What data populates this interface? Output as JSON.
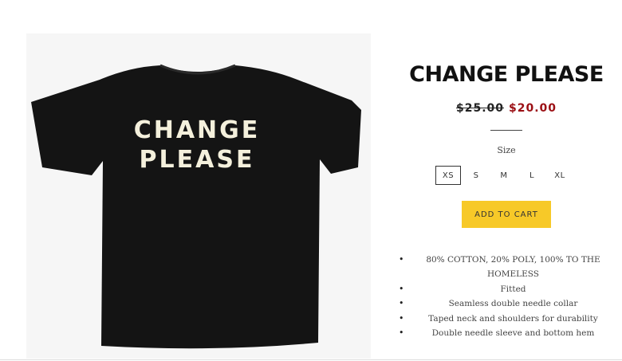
{
  "product": {
    "title": "CHANGE PLEASE",
    "price_original": "$25.00",
    "price_sale": "$20.00",
    "shirt_print_line1": "CHANGE",
    "shirt_print_line2": "PLEASE"
  },
  "size_selector": {
    "label": "Size",
    "options": [
      "XS",
      "S",
      "M",
      "L",
      "XL"
    ],
    "selected": "XS"
  },
  "add_to_cart_label": "ADD TO CART",
  "features": [
    "80% COTTON, 20% POLY, 100% TO THE HOMELESS",
    "Fitted",
    "Seamless double needle collar",
    "Taped neck and shoulders for durability",
    "Double needle sleeve and bottom hem"
  ],
  "colors": {
    "sale_price": "#9b0f14",
    "button": "#f7c928",
    "shirt": "#141414",
    "shirt_print": "#f4f0dc"
  }
}
